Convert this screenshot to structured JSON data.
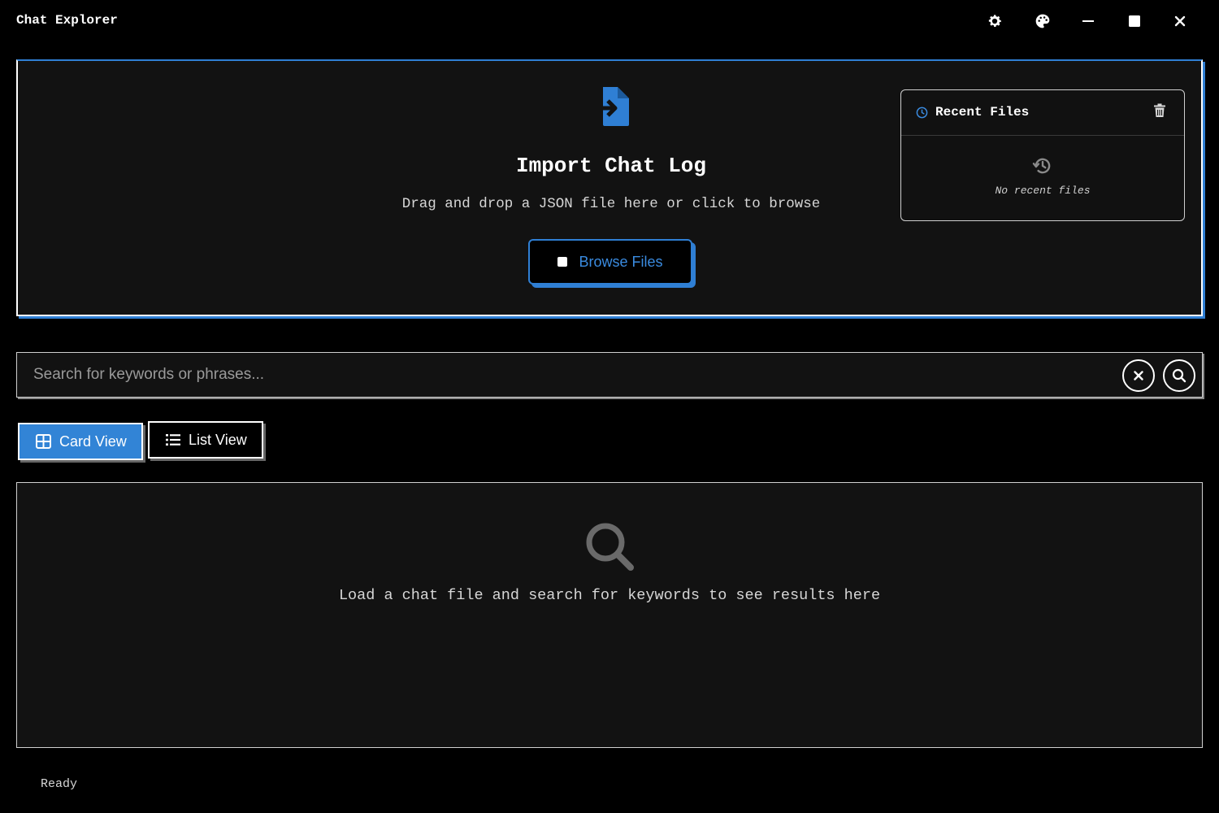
{
  "app": {
    "title": "Chat Explorer"
  },
  "titlebar": {
    "buttons": [
      "gear-icon",
      "palette-icon",
      "minimize-icon",
      "maximize-icon",
      "close-icon"
    ]
  },
  "import_panel": {
    "title": "Import Chat Log",
    "subtitle": "Drag and drop a JSON file here or click to browse",
    "browse_label": "Browse Files",
    "icon": "file-import-icon"
  },
  "recent_files": {
    "title": "Recent Files",
    "empty_text": "No recent files",
    "icons": [
      "clock-icon",
      "trash-icon",
      "history-icon"
    ]
  },
  "search": {
    "placeholder": "Search for keywords or phrases...",
    "value": ""
  },
  "views": {
    "card_label": "Card View",
    "list_label": "List View",
    "selected": "Card View"
  },
  "results": {
    "empty_text": "Load a chat file and search for keywords to see results here",
    "icon": "search-icon"
  },
  "status": {
    "text": "Ready"
  },
  "colors": {
    "accent": "#3284d6",
    "background": "#000000",
    "panel": "#121212"
  }
}
